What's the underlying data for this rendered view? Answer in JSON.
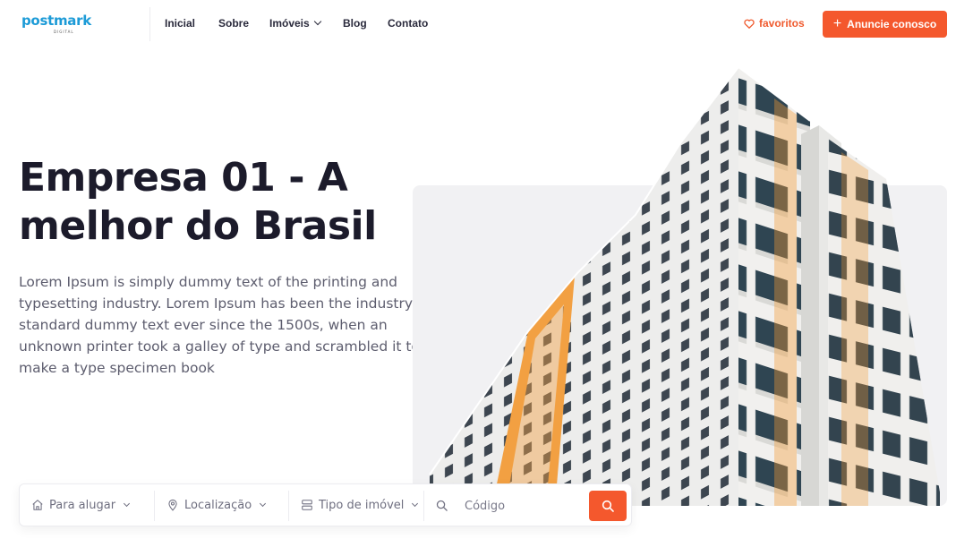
{
  "header": {
    "logo_text": "postmark",
    "logo_sub": "DIGITAL",
    "nav": [
      {
        "label": "Inicial"
      },
      {
        "label": "Sobre"
      },
      {
        "label": "Imóveis"
      },
      {
        "label": "Blog"
      },
      {
        "label": "Contato"
      }
    ],
    "favorites_label": "favoritos",
    "cta_label": "Anuncie conosco"
  },
  "hero": {
    "title": "Empresa 01 - A melhor do Brasil",
    "description": "Lorem Ipsum is simply dummy text of the printing and typesetting industry. Lorem Ipsum has been the industry's standard dummy text ever since the 1500s, when an unknown printer took a galley of type and scrambled it to make a type specimen book"
  },
  "search": {
    "type_label": "Para alugar",
    "location_label": "Localização",
    "property_type_label": "Tipo de imóvel",
    "code_placeholder": "Código"
  },
  "colors": {
    "accent": "#f4582d",
    "logo": "#1d9bd7",
    "text_dark": "#1c1b2b",
    "text_muted": "#5d5d6e",
    "image_bg": "#f1f1f3"
  },
  "icons": [
    "heart-icon",
    "plus-icon",
    "home-icon",
    "map-pin-icon",
    "layers-icon",
    "search-icon",
    "chevron-down-icon"
  ]
}
